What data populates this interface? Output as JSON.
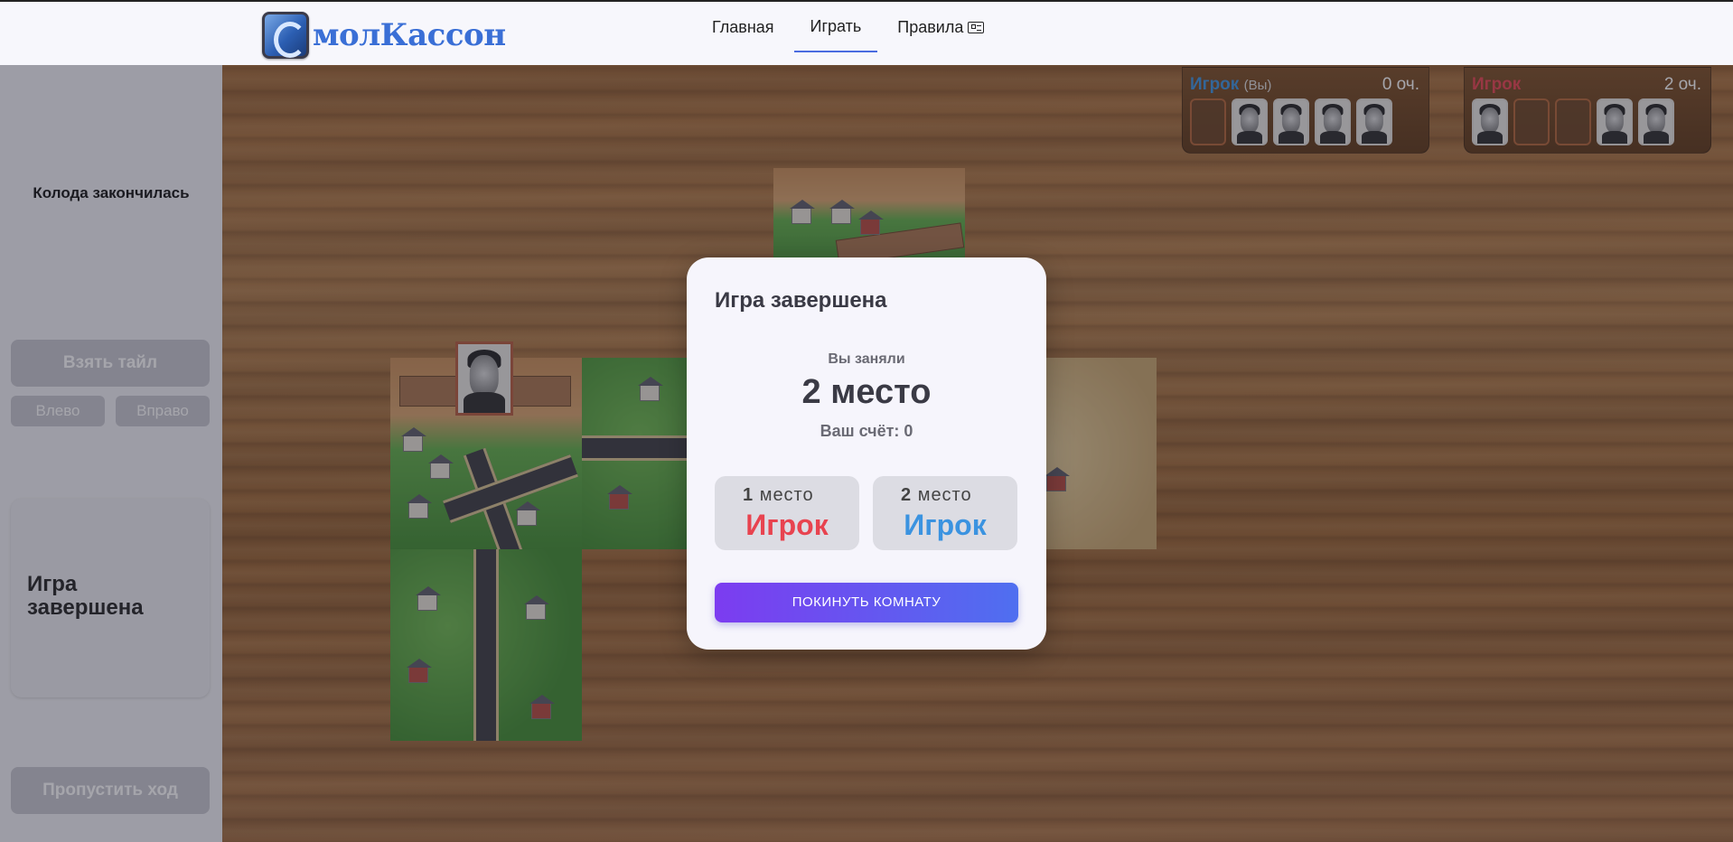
{
  "header": {
    "logo_text": "молКассон",
    "nav": [
      {
        "label": "Главная",
        "active": false
      },
      {
        "label": "Играть",
        "active": true
      },
      {
        "label": "Правила",
        "active": false
      }
    ]
  },
  "sidebar": {
    "deck_status": "Колода закончилась",
    "take_tile": "Взять тайл",
    "rotate_left": "Влево",
    "rotate_right": "Вправо",
    "game_status": "Игра завершена",
    "skip_turn": "Пропустить ход"
  },
  "players": [
    {
      "name": "Игрок",
      "you_label": "(Вы)",
      "score": "0 оч.",
      "color": "#3b93e0"
    },
    {
      "name": "Игрок",
      "score": "2 оч.",
      "color": "#e8434f"
    }
  ],
  "modal": {
    "title": "Игра завершена",
    "took_label": "Вы заняли",
    "place": "2 место",
    "score": "Ваш счёт: 0",
    "ranking": [
      {
        "num": "1",
        "place_word": "место",
        "name": "Игрок",
        "color": "#e8434f"
      },
      {
        "num": "2",
        "place_word": "место",
        "name": "Игрок",
        "color": "#3b93e0"
      }
    ],
    "leave_button": "ПОКИНУТЬ КОМНАТУ"
  },
  "colors": {
    "accent": "#4f6ff0",
    "player_red": "#e8434f",
    "player_blue": "#3b93e0"
  }
}
